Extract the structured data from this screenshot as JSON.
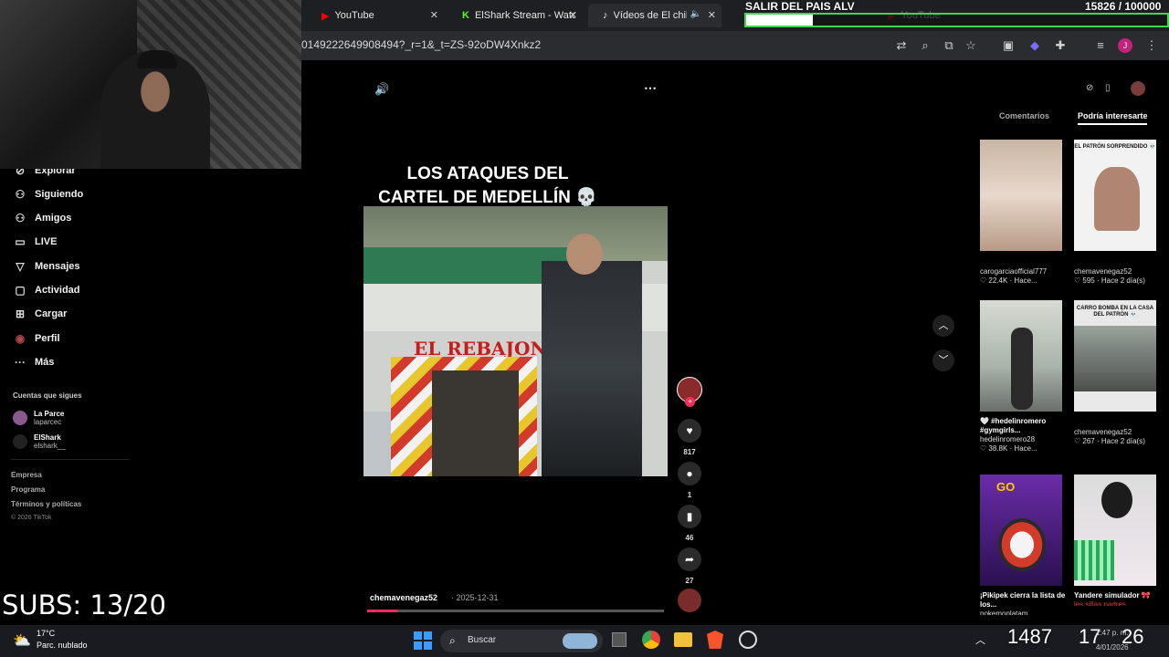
{
  "browser": {
    "tabs": [
      {
        "label": "YouTube"
      },
      {
        "label": "ElShark Stream - Watch"
      },
      {
        "label": "Vídeos de El chili"
      },
      {
        "label": "YouTube"
      }
    ],
    "url": "0149222649908494?_r=1&_t=ZS-92oDW4Xnkz2",
    "accent": "#fe2c55"
  },
  "overlay": {
    "goal_title": "SALIR DEL PAIS ALV",
    "goal_count": "15826 / 100000",
    "goal_progress": 0.158,
    "subs": "SUBS: 13/20"
  },
  "sidebar": {
    "items": [
      {
        "label": "Explorar",
        "icon": "compass-icon"
      },
      {
        "label": "Siguiendo",
        "icon": "person-icon"
      },
      {
        "label": "Amigos",
        "icon": "friends-icon"
      },
      {
        "label": "LIVE",
        "icon": "live-icon"
      },
      {
        "label": "Mensajes",
        "icon": "send-icon"
      },
      {
        "label": "Actividad",
        "icon": "inbox-icon"
      },
      {
        "label": "Cargar",
        "icon": "plus-icon"
      },
      {
        "label": "Perfil",
        "icon": "avatar-icon"
      },
      {
        "label": "Más",
        "icon": "more-icon"
      }
    ],
    "following_title": "Cuentas que sigues",
    "following": [
      {
        "name": "La Parce",
        "handle": "laparcec"
      },
      {
        "name": "ElShark",
        "handle": "elshark__"
      }
    ],
    "footer": [
      "Empresa",
      "Programa",
      "Términos y políticas",
      "© 2026 TikTok"
    ]
  },
  "video": {
    "caption_line1": "LOS ATAQUES DEL",
    "caption_line2": "CARTEL DE MEDELLÍN 💀",
    "sign_text": "EL REBAJON",
    "author": "chemavenegaz52",
    "date": "· 2025-12-31",
    "progress": 0.1,
    "likes": "817",
    "comments": "1",
    "saves": "46",
    "shares": "27"
  },
  "right": {
    "tab_comments": "Comentarios",
    "tab_interest": "Podría interesarte",
    "items": [
      {
        "user": "carogarciaofficial777",
        "stats": "♡ 22.4K · Hace..."
      },
      {
        "user": "chemavenegaz52",
        "stats": "♡ 595 · Hace 2 día(s)",
        "overlay": "EL PATRÓN SORPRENDIDO 💀"
      },
      {
        "title": "🤍 #hedelinromero #gymgirls...",
        "user": "hedelinromero28",
        "stats": "♡ 38.8K · Hace..."
      },
      {
        "user": "chemavenegaz52",
        "stats": "♡ 267 · Hace 2 día(s)",
        "overlay": "CARRO BOMBA EN LA CASA DEL PATRÓN 💀"
      },
      {
        "title": "¡Pikipek cierra la lista de los...",
        "user": "pokemonlatam"
      },
      {
        "title": "Yandere simulador 🎀",
        "user": "les.sillas.padres"
      }
    ]
  },
  "taskbar": {
    "weather_temp": "17°C",
    "weather_desc": "Parc. nublado",
    "search": "Buscar",
    "time": "1:47 p. m.",
    "date": "4/01/2026",
    "overlay_a": "1487",
    "overlay_b": "17",
    "overlay_c": "26"
  }
}
